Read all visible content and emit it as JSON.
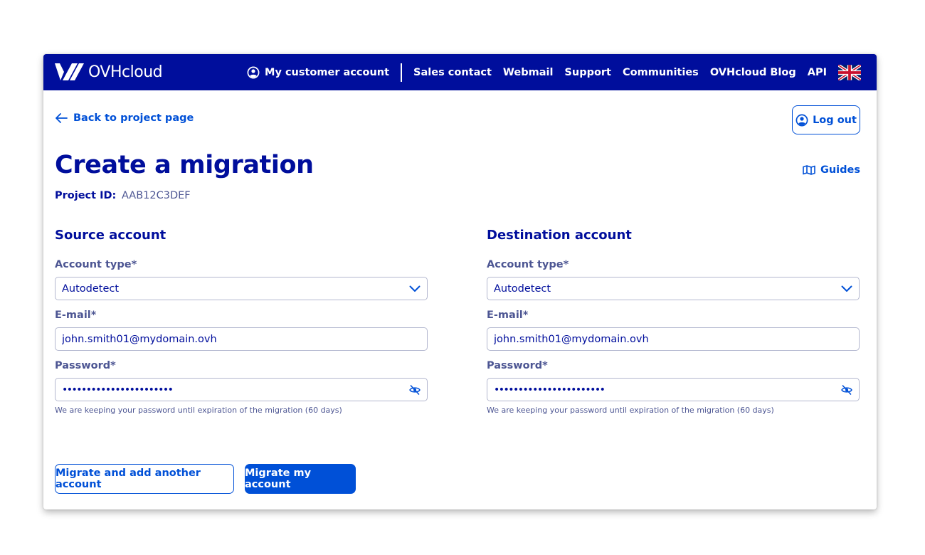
{
  "header": {
    "logo_text": "OVHcloud",
    "nav": {
      "customer_account": "My customer account",
      "sales_contact": "Sales contact",
      "webmail": "Webmail",
      "support": "Support",
      "communities": "Communities",
      "blog": "OVHcloud Blog",
      "api": "API"
    },
    "language_icon": "uk-flag-icon"
  },
  "page": {
    "back_link": "Back to project page",
    "logout": "Log out",
    "title": "Create a migration",
    "guides": "Guides",
    "project_id_label": "Project ID:",
    "project_id_value": "AAB12C3DEF"
  },
  "source": {
    "title": "Source account",
    "account_type_label": "Account type*",
    "account_type_value": "Autodetect",
    "email_label": "E-mail*",
    "email_value": "john.smith01@mydomain.ovh",
    "password_label": "Password*",
    "password_value": "•••••••••••••••••••••••",
    "password_hint": "We are keeping your password until expiration of the migration (60 days)"
  },
  "destination": {
    "title": "Destination account",
    "account_type_label": "Account type*",
    "account_type_value": "Autodetect",
    "email_label": "E-mail*",
    "email_value": "john.smith01@mydomain.ovh",
    "password_label": "Password*",
    "password_value": "•••••••••••••••••••••••",
    "password_hint": "We are keeping your password until expiration of the migration (60 days)"
  },
  "actions": {
    "migrate_and_add": "Migrate and add another account",
    "migrate": "Migrate my account"
  },
  "colors": {
    "header_bg": "#000e9c",
    "primary": "#0050d7",
    "text_dark": "#000e9c",
    "text_muted": "#4d5693",
    "border": "#b3b7cf"
  }
}
